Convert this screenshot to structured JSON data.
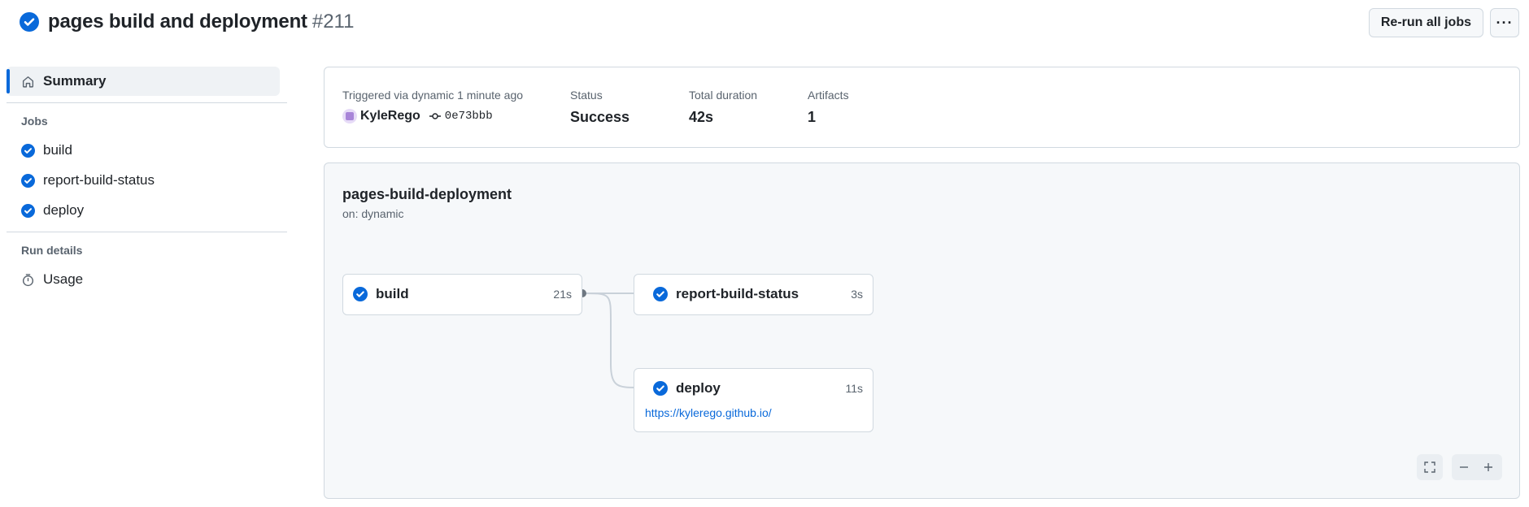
{
  "header": {
    "title": "pages build and deployment",
    "run_number": "#211",
    "rerun_label": "Re-run all jobs",
    "more_label": "···",
    "status_icon": "check-circle-fill-icon"
  },
  "sidebar": {
    "summary_label": "Summary",
    "jobs_heading": "Jobs",
    "jobs": [
      {
        "label": "build"
      },
      {
        "label": "report-build-status"
      },
      {
        "label": "deploy"
      }
    ],
    "run_details_heading": "Run details",
    "usage_label": "Usage"
  },
  "summary": {
    "trigger_label": "Triggered via dynamic 1 minute ago",
    "actor": "KyleRego",
    "commit": "0e73bbb",
    "status_label": "Status",
    "status_value": "Success",
    "duration_label": "Total duration",
    "duration_value": "42s",
    "artifacts_label": "Artifacts",
    "artifacts_value": "1"
  },
  "workflow": {
    "name": "pages-build-deployment",
    "trigger": "on: dynamic",
    "jobs": {
      "build": {
        "name": "build",
        "duration": "21s"
      },
      "report": {
        "name": "report-build-status",
        "duration": "3s"
      },
      "deploy": {
        "name": "deploy",
        "duration": "11s",
        "url": "https://kylerego.github.io/"
      }
    }
  },
  "colors": {
    "accent": "#0969da",
    "muted": "#59636e",
    "border": "#d1d9e0",
    "canvas": "#f6f8fa"
  }
}
